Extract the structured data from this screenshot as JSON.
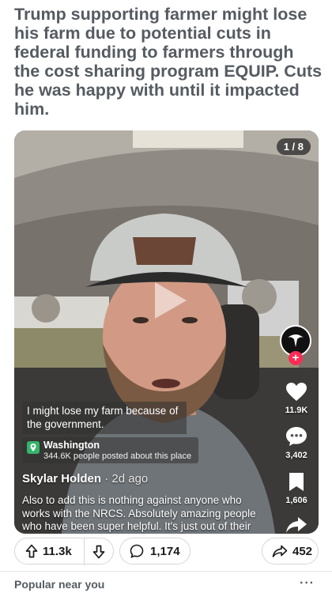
{
  "post": {
    "title": "Trump supporting farmer might lose his farm due to potential cuts in federal funding to farmers through the cost sharing program EQUIP. Cuts he was happy with until it impacted him."
  },
  "media": {
    "counter": "1 / 8",
    "caption": "I might lose my farm because of the government.",
    "location": {
      "name": "Washington",
      "subtitle": "344.6K people posted about this place"
    },
    "author": "Skylar Holden",
    "separator": "·",
    "age": "2d ago",
    "description": "Also to add this is nothing against anyone who works with the NRCS. Absolutely amazing people who have been super helpful. It's just out of their hands. I have never been",
    "side_actions": {
      "likes": "11.9K",
      "comments": "3,402",
      "saves": "1,606"
    }
  },
  "actions": {
    "upvotes": "11.3k",
    "comments": "1,174",
    "shares": "452"
  },
  "footer": {
    "section_label": "Popular near you",
    "more_label": "···"
  }
}
